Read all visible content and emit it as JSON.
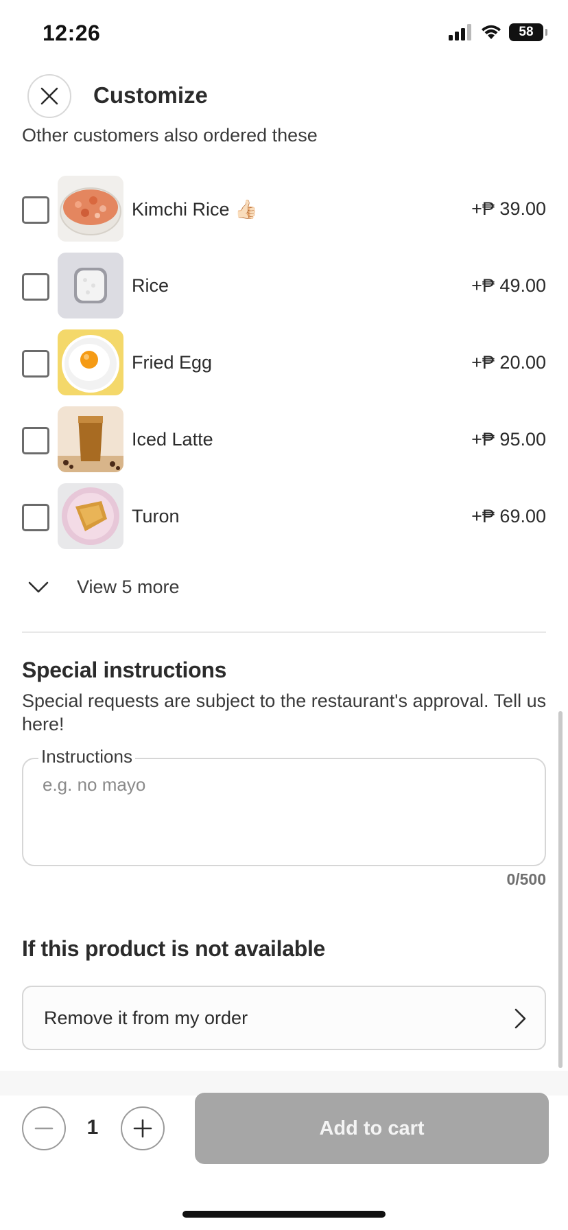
{
  "status_bar": {
    "time": "12:26",
    "battery": "58"
  },
  "header": {
    "title": "Customize"
  },
  "addons": {
    "subtitle": "Other customers also ordered these",
    "items": [
      {
        "name": "Kimchi Rice",
        "emoji": "👍🏻",
        "price": "+₱ 39.00",
        "checked": false
      },
      {
        "name": "Rice",
        "emoji": "",
        "price": "+₱ 49.00",
        "checked": false
      },
      {
        "name": "Fried Egg",
        "emoji": "",
        "price": "+₱ 20.00",
        "checked": false
      },
      {
        "name": "Iced Latte",
        "emoji": "",
        "price": "+₱ 95.00",
        "checked": false
      },
      {
        "name": "Turon",
        "emoji": "",
        "price": "+₱ 69.00",
        "checked": false
      }
    ],
    "view_more_label": "View 5 more"
  },
  "special_instructions": {
    "title": "Special instructions",
    "description": "Special requests are subject to the restaurant's approval. Tell us here!",
    "field_label": "Instructions",
    "placeholder": "e.g. no mayo",
    "value": "",
    "char_count": "0/500"
  },
  "unavailable": {
    "title": "If this product is not available",
    "selected_option": "Remove it from my order"
  },
  "footer": {
    "quantity": "1",
    "add_to_cart_label": "Add to cart"
  },
  "colors": {
    "text": "#2b2b2b",
    "disabled_button": "#a6a6a6",
    "border": "#d6d6d6"
  },
  "icons": {
    "close": "close-icon",
    "chevron_down": "chevron-down-icon",
    "chevron_right": "chevron-right-icon",
    "minus": "minus-icon",
    "plus": "plus-icon"
  }
}
